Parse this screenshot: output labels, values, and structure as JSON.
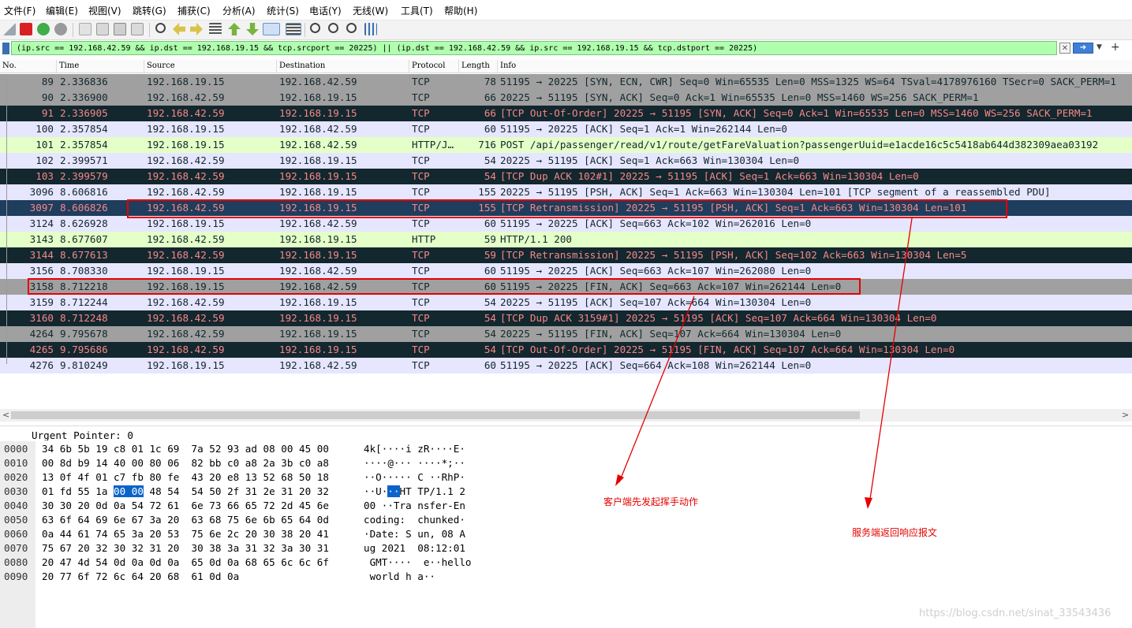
{
  "menu": [
    "文件(F)",
    "编辑(E)",
    "视图(V)",
    "跳转(G)",
    "捕获(C)",
    "分析(A)",
    "统计(S)",
    "电话(Y)",
    "无线(W)",
    "工具(T)",
    "帮助(H)"
  ],
  "filter": {
    "text": "(ip.src == 192.168.42.59 && ip.dst == 192.168.19.15 && tcp.srcport == 20225) || (ip.dst == 192.168.42.59 && ip.src == 192.168.19.15 && tcp.dstport == 20225)"
  },
  "columns": {
    "no": "No.",
    "time": "Time",
    "source": "Source",
    "destination": "Destination",
    "protocol": "Protocol",
    "length": "Length",
    "info": "Info"
  },
  "packets": [
    {
      "no": "89",
      "time": "2.336836",
      "src": "192.168.19.15",
      "dst": "192.168.42.59",
      "proto": "TCP",
      "len": "78",
      "info": "51195 → 20225 [SYN, ECN, CWR] Seq=0 Win=65535 Len=0 MSS=1325 WS=64 TSval=4178976160 TSecr=0 SACK_PERM=1",
      "style": "syn"
    },
    {
      "no": "90",
      "time": "2.336900",
      "src": "192.168.42.59",
      "dst": "192.168.19.15",
      "proto": "TCP",
      "len": "66",
      "info": "20225 → 51195 [SYN, ACK] Seq=0 Ack=1 Win=65535 Len=0 MSS=1460 WS=256 SACK_PERM=1",
      "style": "syn"
    },
    {
      "no": "91",
      "time": "2.336905",
      "src": "192.168.42.59",
      "dst": "192.168.19.15",
      "proto": "TCP",
      "len": "66",
      "info": "[TCP Out-Of-Order] 20225 → 51195 [SYN, ACK] Seq=0 Ack=1 Win=65535 Len=0 MSS=1460 WS=256 SACK_PERM=1",
      "style": "bad"
    },
    {
      "no": "100",
      "time": "2.357854",
      "src": "192.168.19.15",
      "dst": "192.168.42.59",
      "proto": "TCP",
      "len": "60",
      "info": "51195 → 20225 [ACK] Seq=1 Ack=1 Win=262144 Len=0",
      "style": "tcp"
    },
    {
      "no": "101",
      "time": "2.357854",
      "src": "192.168.19.15",
      "dst": "192.168.42.59",
      "proto": "HTTP/J…",
      "len": "716",
      "info": "POST /api/passenger/read/v1/route/getFareValuation?passengerUuid=e1acde16c5c5418ab644d382309aea03192",
      "style": "http"
    },
    {
      "no": "102",
      "time": "2.399571",
      "src": "192.168.42.59",
      "dst": "192.168.19.15",
      "proto": "TCP",
      "len": "54",
      "info": "20225 → 51195 [ACK] Seq=1 Ack=663 Win=130304 Len=0",
      "style": "tcp"
    },
    {
      "no": "103",
      "time": "2.399579",
      "src": "192.168.42.59",
      "dst": "192.168.19.15",
      "proto": "TCP",
      "len": "54",
      "info": "[TCP Dup ACK 102#1] 20225 → 51195 [ACK] Seq=1 Ack=663 Win=130304 Len=0",
      "style": "bad"
    },
    {
      "no": "3096",
      "time": "8.606816",
      "src": "192.168.42.59",
      "dst": "192.168.19.15",
      "proto": "TCP",
      "len": "155",
      "info": "20225 → 51195 [PSH, ACK] Seq=1 Ack=663 Win=130304 Len=101 [TCP segment of a reassembled PDU]",
      "style": "tcp"
    },
    {
      "no": "3097",
      "time": "8.606826",
      "src": "192.168.42.59",
      "dst": "192.168.19.15",
      "proto": "TCP",
      "len": "155",
      "info": "[TCP Retransmission] 20225 → 51195 [PSH, ACK] Seq=1 Ack=663 Win=130304 Len=101",
      "style": "sel"
    },
    {
      "no": "3124",
      "time": "8.626928",
      "src": "192.168.19.15",
      "dst": "192.168.42.59",
      "proto": "TCP",
      "len": "60",
      "info": "51195 → 20225 [ACK] Seq=663 Ack=102 Win=262016 Len=0",
      "style": "tcp"
    },
    {
      "no": "3143",
      "time": "8.677607",
      "src": "192.168.42.59",
      "dst": "192.168.19.15",
      "proto": "HTTP",
      "len": "59",
      "info": "HTTP/1.1 200",
      "style": "http"
    },
    {
      "no": "3144",
      "time": "8.677613",
      "src": "192.168.42.59",
      "dst": "192.168.19.15",
      "proto": "TCP",
      "len": "59",
      "info": "[TCP Retransmission] 20225 → 51195 [PSH, ACK] Seq=102 Ack=663 Win=130304 Len=5",
      "style": "bad"
    },
    {
      "no": "3156",
      "time": "8.708330",
      "src": "192.168.19.15",
      "dst": "192.168.42.59",
      "proto": "TCP",
      "len": "60",
      "info": "51195 → 20225 [ACK] Seq=663 Ack=107 Win=262080 Len=0",
      "style": "tcp"
    },
    {
      "no": "3158",
      "time": "8.712218",
      "src": "192.168.19.15",
      "dst": "192.168.42.59",
      "proto": "TCP",
      "len": "60",
      "info": "51195 → 20225 [FIN, ACK] Seq=663 Ack=107 Win=262144 Len=0",
      "style": "syn"
    },
    {
      "no": "3159",
      "time": "8.712244",
      "src": "192.168.42.59",
      "dst": "192.168.19.15",
      "proto": "TCP",
      "len": "54",
      "info": "20225 → 51195 [ACK] Seq=107 Ack=664 Win=130304 Len=0",
      "style": "tcp"
    },
    {
      "no": "3160",
      "time": "8.712248",
      "src": "192.168.42.59",
      "dst": "192.168.19.15",
      "proto": "TCP",
      "len": "54",
      "info": "[TCP Dup ACK 3159#1] 20225 → 51195 [ACK] Seq=107 Ack=664 Win=130304 Len=0",
      "style": "bad"
    },
    {
      "no": "4264",
      "time": "9.795678",
      "src": "192.168.42.59",
      "dst": "192.168.19.15",
      "proto": "TCP",
      "len": "54",
      "info": "20225 → 51195 [FIN, ACK] Seq=107 Ack=664 Win=130304 Len=0",
      "style": "syn"
    },
    {
      "no": "4265",
      "time": "9.795686",
      "src": "192.168.42.59",
      "dst": "192.168.19.15",
      "proto": "TCP",
      "len": "54",
      "info": "[TCP Out-Of-Order] 20225 → 51195 [FIN, ACK] Seq=107 Ack=664 Win=130304 Len=0",
      "style": "bad"
    },
    {
      "no": "4276",
      "time": "9.810249",
      "src": "192.168.19.15",
      "dst": "192.168.42.59",
      "proto": "TCP",
      "len": "60",
      "info": "51195 → 20225 [ACK] Seq=664 Ack=108 Win=262144 Len=0",
      "style": "tcp"
    }
  ],
  "detail": {
    "partial_line": "Urgent Pointer: 0"
  },
  "hex": [
    {
      "off": "0000",
      "bytes": "34 6b 5b 19 c8 01 1c 69  7a 52 93 ad 08 00 45 00",
      "ascii": "4k[····i zR····E·"
    },
    {
      "off": "0010",
      "bytes": "00 8d b9 14 40 00 80 06  82 bb c0 a8 2a 3b c0 a8",
      "ascii": "····@··· ····*;··"
    },
    {
      "off": "0020",
      "bytes": "13 0f 4f 01 c7 fb 80 fe  43 20 e8 13 52 68 50 18",
      "ascii": "··O····· C ··RhP·"
    },
    {
      "off": "0030",
      "bytes_pre": "01 fd 55 1a ",
      "bytes_sel": "00 00",
      "bytes_post": " 48 54  54 50 2f 31 2e 31 20 32",
      "ascii_pre": "··U·",
      "ascii_sel": "··",
      "ascii_post": "HT TP/1.1 2"
    },
    {
      "off": "0040",
      "bytes": "30 30 20 0d 0a 54 72 61  6e 73 66 65 72 2d 45 6e",
      "ascii": "00 ··Tra nsfer-En"
    },
    {
      "off": "0050",
      "bytes": "63 6f 64 69 6e 67 3a 20  63 68 75 6e 6b 65 64 0d",
      "ascii": "coding:  chunked·"
    },
    {
      "off": "0060",
      "bytes": "0a 44 61 74 65 3a 20 53  75 6e 2c 20 30 38 20 41",
      "ascii": "·Date: S un, 08 A"
    },
    {
      "off": "0070",
      "bytes": "75 67 20 32 30 32 31 20  30 38 3a 31 32 3a 30 31",
      "ascii": "ug 2021  08:12:01"
    },
    {
      "off": "0080",
      "bytes": "20 47 4d 54 0d 0a 0d 0a  65 0d 0a 68 65 6c 6c 6f",
      "ascii": " GMT····  e··hello"
    },
    {
      "off": "0090",
      "bytes": "20 77 6f 72 6c 64 20 68  61 0d 0a",
      "ascii": " world h a··"
    }
  ],
  "annotations": {
    "client_note": "客户端先发起挥手动作",
    "server_note": "服务端返回响应报文"
  },
  "watermark": "https://blog.csdn.net/sinat_33543436",
  "colors": {
    "syn_bg": "#a0a0a0",
    "bad_bg": "#12272e",
    "bad_fg": "#f78787",
    "tcp_bg": "#e7e6ff",
    "http_bg": "#e4ffc7",
    "selected_bg": "#1f3d5c",
    "annotation": "#e60000",
    "filter_bg": "#afffaf"
  }
}
